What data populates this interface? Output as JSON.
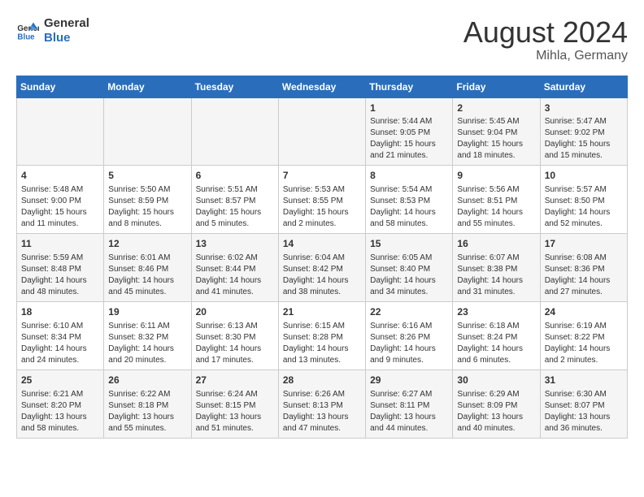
{
  "logo": {
    "line1": "General",
    "line2": "Blue"
  },
  "title": "August 2024",
  "location": "Mihla, Germany",
  "days_of_week": [
    "Sunday",
    "Monday",
    "Tuesday",
    "Wednesday",
    "Thursday",
    "Friday",
    "Saturday"
  ],
  "weeks": [
    [
      {
        "day": "",
        "content": ""
      },
      {
        "day": "",
        "content": ""
      },
      {
        "day": "",
        "content": ""
      },
      {
        "day": "",
        "content": ""
      },
      {
        "day": "1",
        "content": "Sunrise: 5:44 AM\nSunset: 9:05 PM\nDaylight: 15 hours\nand 21 minutes."
      },
      {
        "day": "2",
        "content": "Sunrise: 5:45 AM\nSunset: 9:04 PM\nDaylight: 15 hours\nand 18 minutes."
      },
      {
        "day": "3",
        "content": "Sunrise: 5:47 AM\nSunset: 9:02 PM\nDaylight: 15 hours\nand 15 minutes."
      }
    ],
    [
      {
        "day": "4",
        "content": "Sunrise: 5:48 AM\nSunset: 9:00 PM\nDaylight: 15 hours\nand 11 minutes."
      },
      {
        "day": "5",
        "content": "Sunrise: 5:50 AM\nSunset: 8:59 PM\nDaylight: 15 hours\nand 8 minutes."
      },
      {
        "day": "6",
        "content": "Sunrise: 5:51 AM\nSunset: 8:57 PM\nDaylight: 15 hours\nand 5 minutes."
      },
      {
        "day": "7",
        "content": "Sunrise: 5:53 AM\nSunset: 8:55 PM\nDaylight: 15 hours\nand 2 minutes."
      },
      {
        "day": "8",
        "content": "Sunrise: 5:54 AM\nSunset: 8:53 PM\nDaylight: 14 hours\nand 58 minutes."
      },
      {
        "day": "9",
        "content": "Sunrise: 5:56 AM\nSunset: 8:51 PM\nDaylight: 14 hours\nand 55 minutes."
      },
      {
        "day": "10",
        "content": "Sunrise: 5:57 AM\nSunset: 8:50 PM\nDaylight: 14 hours\nand 52 minutes."
      }
    ],
    [
      {
        "day": "11",
        "content": "Sunrise: 5:59 AM\nSunset: 8:48 PM\nDaylight: 14 hours\nand 48 minutes."
      },
      {
        "day": "12",
        "content": "Sunrise: 6:01 AM\nSunset: 8:46 PM\nDaylight: 14 hours\nand 45 minutes."
      },
      {
        "day": "13",
        "content": "Sunrise: 6:02 AM\nSunset: 8:44 PM\nDaylight: 14 hours\nand 41 minutes."
      },
      {
        "day": "14",
        "content": "Sunrise: 6:04 AM\nSunset: 8:42 PM\nDaylight: 14 hours\nand 38 minutes."
      },
      {
        "day": "15",
        "content": "Sunrise: 6:05 AM\nSunset: 8:40 PM\nDaylight: 14 hours\nand 34 minutes."
      },
      {
        "day": "16",
        "content": "Sunrise: 6:07 AM\nSunset: 8:38 PM\nDaylight: 14 hours\nand 31 minutes."
      },
      {
        "day": "17",
        "content": "Sunrise: 6:08 AM\nSunset: 8:36 PM\nDaylight: 14 hours\nand 27 minutes."
      }
    ],
    [
      {
        "day": "18",
        "content": "Sunrise: 6:10 AM\nSunset: 8:34 PM\nDaylight: 14 hours\nand 24 minutes."
      },
      {
        "day": "19",
        "content": "Sunrise: 6:11 AM\nSunset: 8:32 PM\nDaylight: 14 hours\nand 20 minutes."
      },
      {
        "day": "20",
        "content": "Sunrise: 6:13 AM\nSunset: 8:30 PM\nDaylight: 14 hours\nand 17 minutes."
      },
      {
        "day": "21",
        "content": "Sunrise: 6:15 AM\nSunset: 8:28 PM\nDaylight: 14 hours\nand 13 minutes."
      },
      {
        "day": "22",
        "content": "Sunrise: 6:16 AM\nSunset: 8:26 PM\nDaylight: 14 hours\nand 9 minutes."
      },
      {
        "day": "23",
        "content": "Sunrise: 6:18 AM\nSunset: 8:24 PM\nDaylight: 14 hours\nand 6 minutes."
      },
      {
        "day": "24",
        "content": "Sunrise: 6:19 AM\nSunset: 8:22 PM\nDaylight: 14 hours\nand 2 minutes."
      }
    ],
    [
      {
        "day": "25",
        "content": "Sunrise: 6:21 AM\nSunset: 8:20 PM\nDaylight: 13 hours\nand 58 minutes."
      },
      {
        "day": "26",
        "content": "Sunrise: 6:22 AM\nSunset: 8:18 PM\nDaylight: 13 hours\nand 55 minutes."
      },
      {
        "day": "27",
        "content": "Sunrise: 6:24 AM\nSunset: 8:15 PM\nDaylight: 13 hours\nand 51 minutes."
      },
      {
        "day": "28",
        "content": "Sunrise: 6:26 AM\nSunset: 8:13 PM\nDaylight: 13 hours\nand 47 minutes."
      },
      {
        "day": "29",
        "content": "Sunrise: 6:27 AM\nSunset: 8:11 PM\nDaylight: 13 hours\nand 44 minutes."
      },
      {
        "day": "30",
        "content": "Sunrise: 6:29 AM\nSunset: 8:09 PM\nDaylight: 13 hours\nand 40 minutes."
      },
      {
        "day": "31",
        "content": "Sunrise: 6:30 AM\nSunset: 8:07 PM\nDaylight: 13 hours\nand 36 minutes."
      }
    ]
  ]
}
